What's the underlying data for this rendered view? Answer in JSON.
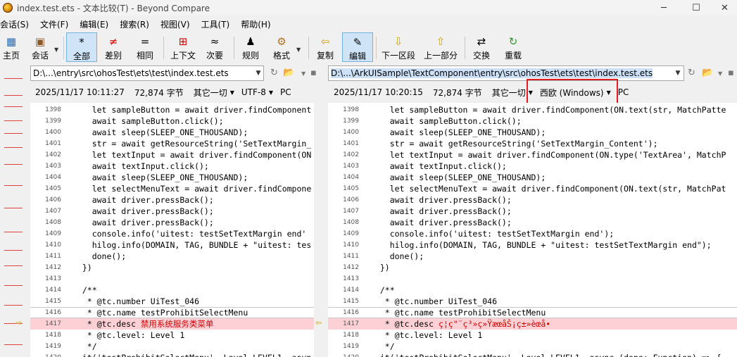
{
  "window": {
    "title": "index.test.ets - 文本比较(T) - Beyond Compare",
    "minimize_glyph": "─",
    "maximize_glyph": "☐",
    "close_glyph": "✕"
  },
  "menu": [
    "会话(S)",
    "文件(F)",
    "编辑(E)",
    "搜索(R)",
    "视图(V)",
    "工具(T)",
    "帮助(H)"
  ],
  "toolbar": {
    "home": "主页",
    "session": "会话",
    "all": "全部",
    "diffs": "差别",
    "same": "相同",
    "context": "上下文",
    "minor": "次要",
    "rules": "规则",
    "format": "格式",
    "copy": "复制",
    "edit": "编辑",
    "next_section": "下一区段",
    "prev_section": "上一部分",
    "swap": "交换",
    "reload": "重载"
  },
  "left": {
    "path": "D:\\...\\entry\\src\\ohosTest\\ets\\test\\index.test.ets",
    "datetime": "2025/11/17 10:11:27",
    "size": "72,874 字节",
    "other": "其它一切",
    "encoding": "UTF-8",
    "line_ending": "PC"
  },
  "right": {
    "path": "D:\\...\\ArkUISample\\TextComponent\\entry\\src\\ohosTest\\ets\\test\\index.test.ets",
    "datetime": "2025/11/17 10:20:15",
    "size": "72,874 字节",
    "other": "其它一切",
    "encoding": "西欧 (Windows)",
    "line_ending": "PC"
  },
  "lines": [
    {
      "n": "1398",
      "l": "    let sampleButton = await driver.findComponent",
      "r": "    let sampleButton = await driver.findComponent(ON.text(str, MatchPatte"
    },
    {
      "n": "1399",
      "l": "    await sampleButton.click();",
      "r": "    await sampleButton.click();"
    },
    {
      "n": "1400",
      "l": "    await sleep(SLEEP_ONE_THOUSAND);",
      "r": "    await sleep(SLEEP_ONE_THOUSAND);"
    },
    {
      "n": "1401",
      "l": "    str = await getResourceString('SetTextMargin_",
      "r": "    str = await getResourceString('SetTextMargin_Content');"
    },
    {
      "n": "1402",
      "l": "    let textInput = await driver.findComponent(ON",
      "r": "    let textInput = await driver.findComponent(ON.type('TextArea', MatchP"
    },
    {
      "n": "1403",
      "l": "    await textInput.click();",
      "r": "    await textInput.click();"
    },
    {
      "n": "1404",
      "l": "    await sleep(SLEEP_ONE_THOUSAND);",
      "r": "    await sleep(SLEEP_ONE_THOUSAND);"
    },
    {
      "n": "1405",
      "l": "    let selectMenuText = await driver.findCompone",
      "r": "    let selectMenuText = await driver.findComponent(ON.text(str, MatchPat"
    },
    {
      "n": "1406",
      "l": "    await driver.pressBack();",
      "r": "    await driver.pressBack();"
    },
    {
      "n": "1407",
      "l": "    await driver.pressBack();",
      "r": "    await driver.pressBack();"
    },
    {
      "n": "1408",
      "l": "    await driver.pressBack();",
      "r": "    await driver.pressBack();"
    },
    {
      "n": "1409",
      "l": "    console.info('uitest: testSetTextMargin end'",
      "r": "    console.info('uitest: testSetTextMargin end');"
    },
    {
      "n": "1410",
      "l": "    hilog.info(DOMAIN, TAG, BUNDLE + \"uitest: tes",
      "r": "    hilog.info(DOMAIN, TAG, BUNDLE + \"uitest: testSetTextMargin end\");"
    },
    {
      "n": "1411",
      "l": "    done();",
      "r": "    done();"
    },
    {
      "n": "1412",
      "l": "  })",
      "r": "  })"
    },
    {
      "n": "1413",
      "l": "",
      "r": ""
    },
    {
      "n": "1414",
      "l": "  /**",
      "r": "  /**"
    },
    {
      "n": "1415",
      "l": "   * @tc.number UiTest_046",
      "r": "   * @tc.number UiTest_046"
    },
    {
      "n": "1416",
      "l": "   * @tc.name testProhibitSelectMenu",
      "r": "   * @tc.name testProhibitSelectMenu"
    },
    {
      "n": "1417",
      "l": "   * @tc.desc ",
      "l_diff": "禁用系统服务类菜单",
      "r": "   * @tc.desc ",
      "r_diff": "ç¦ç\"¨ç³»ç»ŸæœåŠ¡ç±»èœå•"
    },
    {
      "n": "1418",
      "l": "   * @tc.level: Level 1",
      "r": "   * @tc.level: Level 1"
    },
    {
      "n": "1419",
      "l": "   */",
      "r": "   */"
    },
    {
      "n": "1420",
      "l": "  it('testProhibitSelectMenu', Level.LEVEL1, asyn",
      "r": "  it('testProhibitSelectMenu', Level.LEVEL1, async (done: Function) => {"
    }
  ]
}
